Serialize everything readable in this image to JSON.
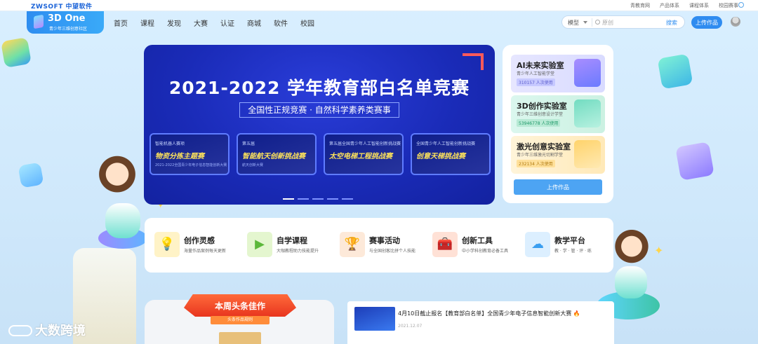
{
  "topbar": {
    "brand": "ZWSOFT 中望软件",
    "links": [
      "青教育网",
      "产品体系",
      "课程体系",
      "校园赛事"
    ]
  },
  "header": {
    "logo_name": "3D One",
    "logo_sub": "青少年三维创意社区",
    "nav": [
      "首页",
      "课程",
      "发现",
      "大赛",
      "认证",
      "商城",
      "软件",
      "校园"
    ],
    "search": {
      "scope": "模型",
      "placeholder": "原创",
      "button": "搜索"
    },
    "upload": "上传作品"
  },
  "banner": {
    "title": "2021-2022 学年教育部白名单竞赛",
    "subtitle": "全国性正规竞赛 · 自然科学素养类赛事",
    "cards": [
      {
        "top": "智能机器人赛项",
        "name": "物资分拣主题赛",
        "sub": "2021-2022全国青少年电子信息智能创新大赛"
      },
      {
        "top": "第五届",
        "name": "智能航天创新挑战赛",
        "sub": "航天创新大赛"
      },
      {
        "top": "第五届全国青少年人工智能创新挑战赛",
        "name": "太空电梯工程挑战赛",
        "sub": ""
      },
      {
        "top": "全国青少年人工智能创新挑战赛",
        "name": "创意天梯挑战赛",
        "sub": ""
      }
    ],
    "slide_count": 5,
    "active_slide": 0
  },
  "labs": {
    "items": [
      {
        "title": "AI未来实验室",
        "sub": "青少年人工智能学堂",
        "count": "310157 人次使用"
      },
      {
        "title": "3D创作实验室",
        "sub": "青少年三维创意设计学堂",
        "count": "53946778 人次使用"
      },
      {
        "title": "激光创意实验室",
        "sub": "青少年三维激光切割学堂",
        "count": "232134 人次使用"
      }
    ],
    "upload": "上传作品"
  },
  "features": [
    {
      "title": "创作灵感",
      "sub": "海量作品案例每天更新",
      "icon": "lightbulb-icon",
      "glyph": "💡"
    },
    {
      "title": "自学课程",
      "sub": "大咖教程助力技能提升",
      "icon": "video-play-icon",
      "glyph": "▶"
    },
    {
      "title": "赛事活动",
      "sub": "与全国创客比拼个人技能",
      "icon": "trophy-icon",
      "glyph": "🏆"
    },
    {
      "title": "创新工具",
      "sub": "中小学科创教育必备工具",
      "icon": "toolbox-icon",
      "glyph": "🧰"
    },
    {
      "title": "教学平台",
      "sub": "教 · 学 · 管 · 评 · 练",
      "icon": "cloud-icon",
      "glyph": "☁"
    }
  ],
  "hot": {
    "title": "本周头条佳作",
    "sub": "头条作品规则"
  },
  "news": [
    {
      "title": "4月10日截止报名【教育部白名单】全国青少年电子信息智能创新大赛",
      "fire": "🔥",
      "date": "2021.12.07"
    }
  ],
  "watermark": "大数跨境"
}
